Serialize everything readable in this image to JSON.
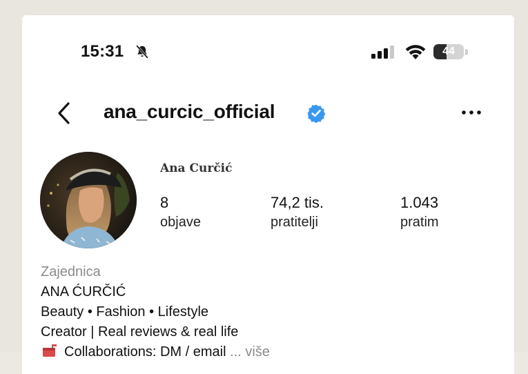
{
  "status_bar": {
    "time": "15:31",
    "battery_level": "44",
    "battery_fraction": 0.44,
    "icons": [
      "bell-slash-icon",
      "cellular-signal-icon",
      "wifi-icon",
      "battery-icon"
    ]
  },
  "header": {
    "username": "ana_curcic_official",
    "verified": true,
    "back_icon": "chevron-left-icon",
    "more_icon": "ellipsis-icon"
  },
  "profile": {
    "display_name": "Ana Curčić",
    "stats": {
      "posts": {
        "value": "8",
        "label": "objave"
      },
      "followers": {
        "value": "74,2 tis.",
        "label": "pratitelji"
      },
      "following": {
        "value": "1.043",
        "label": "pratim"
      }
    }
  },
  "bio": {
    "category": "Zajednica",
    "name_line": "ANA ĆURČIĆ",
    "line1": "Beauty • Fashion • Lifestyle",
    "line2": "Creator | Real reviews & real life",
    "line3": "Collaborations: DM / email",
    "more_link": "... više"
  },
  "colors": {
    "verified_blue": "#3897f0",
    "text_primary": "#111111",
    "text_secondary": "#8a8a8a"
  }
}
